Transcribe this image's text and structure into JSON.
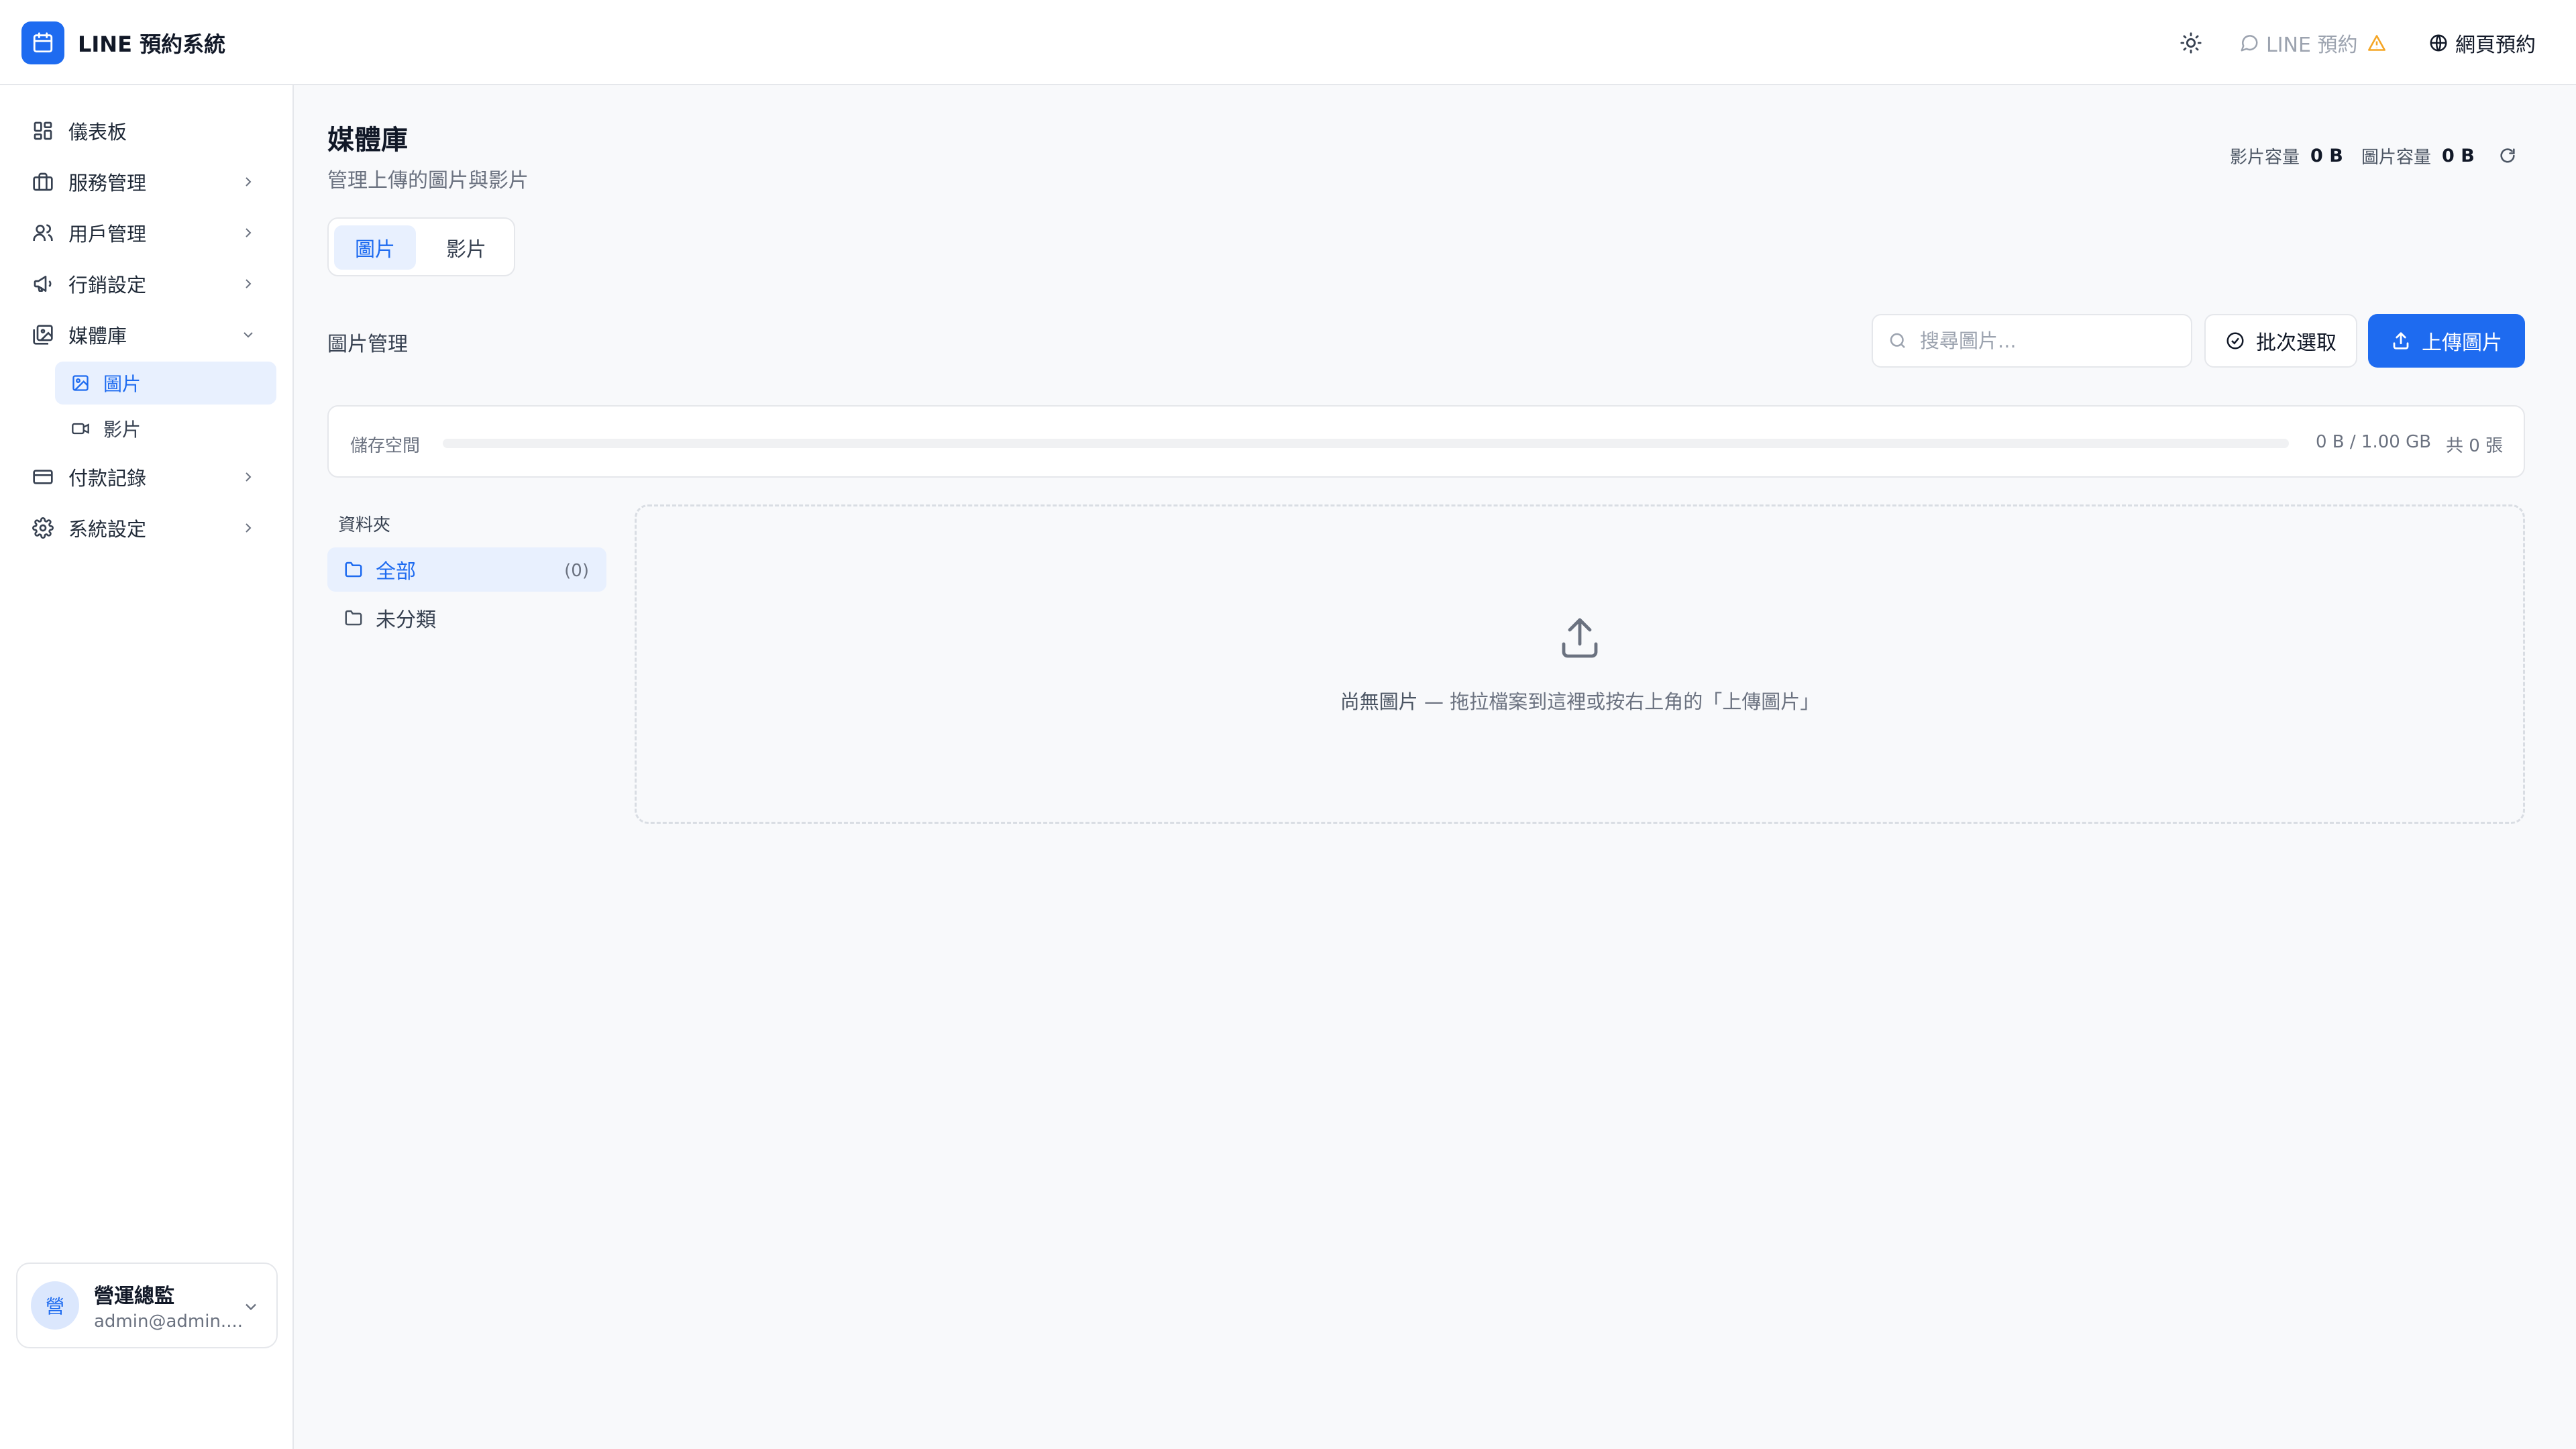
{
  "app": {
    "title": "LINE 預約系統",
    "accent_color": "#1e6bf0"
  },
  "header": {
    "theme_toggle_icon": "sun-icon",
    "line_status_label": "LINE 預約",
    "line_status_warning_icon": "warning-triangle-icon",
    "web_booking_label": "網頁預約"
  },
  "sidebar": {
    "items": [
      {
        "label": "儀表板",
        "icon": "grid-icon"
      },
      {
        "label": "服務管理",
        "icon": "briefcase-icon"
      },
      {
        "label": "用戶管理",
        "icon": "users-icon"
      },
      {
        "label": "行銷設定",
        "icon": "megaphone-icon"
      },
      {
        "label": "媒體庫",
        "icon": "media-icon",
        "expanded": true,
        "children": [
          {
            "label": "圖片",
            "icon": "image-icon",
            "active": true
          },
          {
            "label": "影片",
            "icon": "video-icon"
          }
        ]
      },
      {
        "label": "付款記錄",
        "icon": "credit-card-icon"
      },
      {
        "label": "系統設定",
        "icon": "gear-icon"
      }
    ],
    "user": {
      "avatar_text": "營",
      "name": "營運總監",
      "email": "admin@admin...."
    }
  },
  "main": {
    "title": "媒體庫",
    "subtitle": "管理上傳的圖片與影片",
    "quota": {
      "video_label": "影片容量",
      "video_value": "0 B",
      "image_label": "圖片容量",
      "image_value": "0 B"
    },
    "tabs": [
      {
        "label": "圖片",
        "active": true
      },
      {
        "label": "影片",
        "active": false
      }
    ],
    "section_title": "圖片管理",
    "search_placeholder": "搜尋圖片...",
    "batch_select_label": "批次選取",
    "upload_label": "上傳圖片",
    "storage": {
      "label": "儲存空間",
      "used_fraction": 0,
      "usage_text": "0 B / 1.00 GB",
      "count_text": "共 0 張"
    },
    "folders": {
      "heading": "資料夾",
      "items": [
        {
          "label": "全部",
          "count": "(0)",
          "active": true
        },
        {
          "label": "未分類",
          "count": "",
          "active": false
        }
      ]
    },
    "empty_state": {
      "primary": "尚無圖片",
      "secondary": " — 拖拉檔案到這裡或按右上角的「上傳圖片」"
    }
  }
}
